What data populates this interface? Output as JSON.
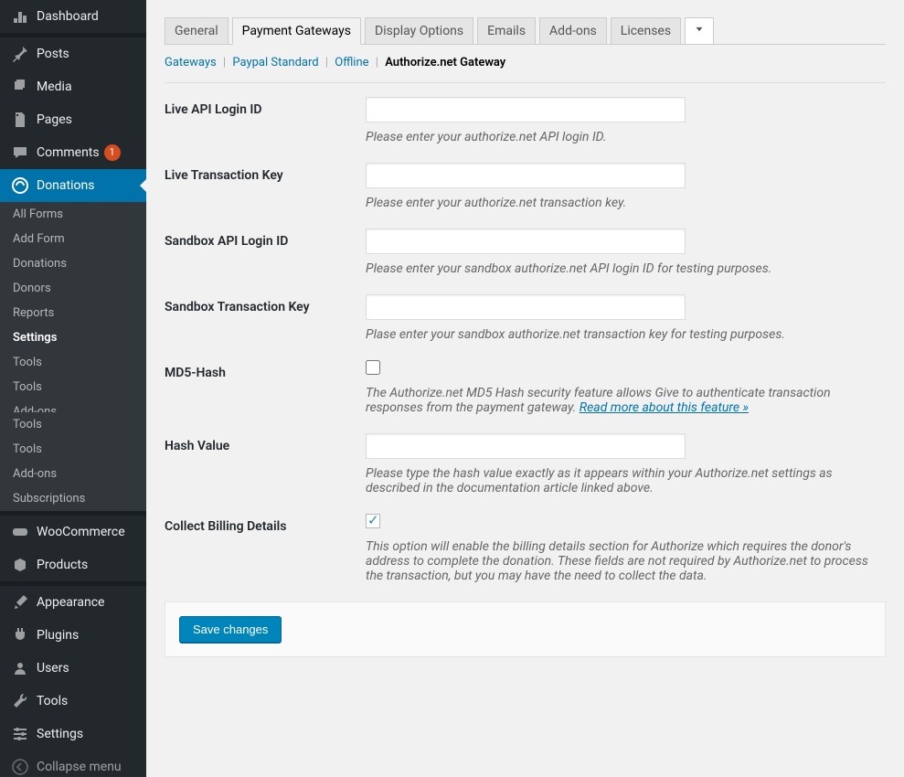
{
  "sidebar": {
    "dashboard": "Dashboard",
    "posts": "Posts",
    "media": "Media",
    "pages": "Pages",
    "comments": "Comments",
    "comments_count": "1",
    "donations": "Donations",
    "woocommerce": "WooCommerce",
    "products": "Products",
    "appearance": "Appearance",
    "plugins": "Plugins",
    "users": "Users",
    "tools": "Tools",
    "settings": "Settings",
    "collapse": "Collapse menu",
    "sub": {
      "all_forms": "All Forms",
      "add_form": "Add Form",
      "donations": "Donations",
      "donors": "Donors",
      "reports": "Reports",
      "settings": "Settings",
      "tools1": "Tools",
      "tools2": "Tools",
      "addons_cut": "Add-ons",
      "tools3": "Tools",
      "tools4": "Tools",
      "addons": "Add-ons",
      "subscriptions": "Subscriptions"
    }
  },
  "tabs": {
    "general": "General",
    "payment_gateways": "Payment Gateways",
    "display_options": "Display Options",
    "emails": "Emails",
    "addons": "Add-ons",
    "licenses": "Licenses"
  },
  "subtabs": {
    "gateways": "Gateways",
    "paypal": "Paypal Standard",
    "offline": "Offline",
    "authorize": "Authorize.net Gateway"
  },
  "fields": {
    "live_api_login": {
      "label": "Live API Login ID",
      "value": "",
      "desc": "Please enter your authorize.net API login ID."
    },
    "live_trans_key": {
      "label": "Live Transaction Key",
      "value": "",
      "desc": "Please enter your authorize.net transaction key."
    },
    "sandbox_api_login": {
      "label": "Sandbox API Login ID",
      "value": "",
      "desc": "Please enter your sandbox authorize.net API login ID for testing purposes."
    },
    "sandbox_trans_key": {
      "label": "Sandbox Transaction Key",
      "value": "",
      "desc": "Plase enter your sandbox authorize.net transaction key for testing purposes."
    },
    "md5_hash": {
      "label": "MD5-Hash",
      "desc": "The Authorize.net MD5 Hash security feature allows Give to authenticate transaction responses from the payment gateway. ",
      "link": "Read more about this feature »"
    },
    "hash_value": {
      "label": "Hash Value",
      "value": "",
      "desc": "Please type the hash value exactly as it appears within your Authorize.net settings as described in the documentation article linked above."
    },
    "billing": {
      "label": "Collect Billing Details",
      "desc": "This option will enable the billing details section for Authorize which requires the donor's address to complete the donation. These fields are not required by Authorize.net to process the transaction, but you may have the need to collect the data."
    }
  },
  "save_button": "Save changes"
}
